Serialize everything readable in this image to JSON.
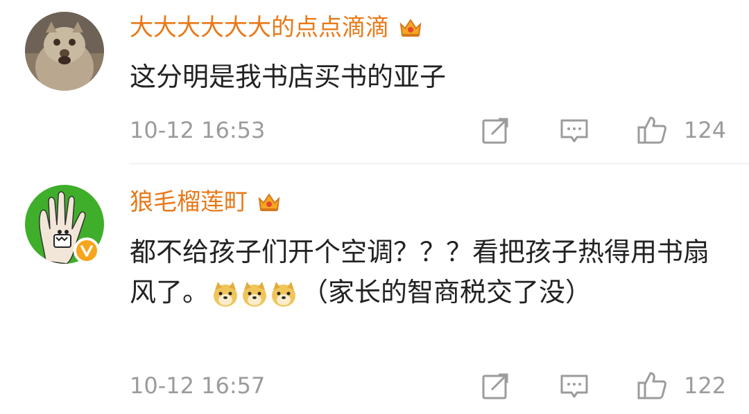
{
  "comments": [
    {
      "username": "大大大大大大的点点滴滴",
      "content": "这分明是我书店买书的亚子",
      "time": "10-12 16:53",
      "likes": "124",
      "avatar": "cat-avatar",
      "verified": false,
      "crown_icon": "crown-icon"
    },
    {
      "username": "狼毛榴莲町",
      "content_before": "都不给孩子们开个空调？？？看把孩子热得用书扇风了。",
      "content_after": "（家长的智商税交了没）",
      "emoji": [
        "doge-emoji",
        "doge-emoji",
        "doge-emoji"
      ],
      "time": "10-12 16:57",
      "likes": "122",
      "avatar": "hand-avatar",
      "verified": true,
      "crown_icon": "crown-icon"
    }
  ],
  "colors": {
    "username": "#e87918",
    "text": "#222222",
    "meta": "#9b9b9b",
    "divider": "#e6e6e6",
    "verified_badge": "#f7a51c"
  },
  "icons": {
    "share": "share-icon",
    "reply": "reply-icon",
    "like": "thumbs-up-icon"
  }
}
